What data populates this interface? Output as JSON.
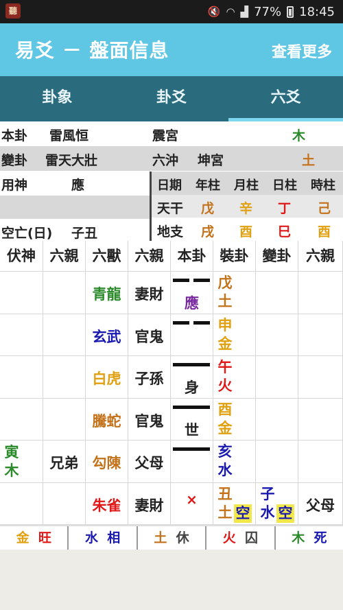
{
  "status_bar": {
    "battery": "77%",
    "time": "18:45",
    "app_icon": "聽"
  },
  "app_bar": {
    "title": "易爻 － 盤面信息",
    "more_button": "查看更多"
  },
  "tabs": [
    {
      "label": "卦象"
    },
    {
      "label": "卦爻"
    },
    {
      "label": "六爻"
    }
  ],
  "info": {
    "ben_gua_label": "本卦",
    "ben_gua_name": "雷風恒",
    "ben_gua_palace": "震宮",
    "ben_gua_element": "木",
    "bian_gua_label": "變卦",
    "bian_gua_name": "雷天大壯",
    "bian_gua_type": "六沖",
    "bian_gua_palace": "坤宮",
    "bian_gua_element": "土",
    "yong_shen_label": "用神",
    "yong_shen_value": "應",
    "kong_wang_label": "空亡(日)",
    "kong_wang_value": "子丑",
    "pillars_header": [
      "日期",
      "年柱",
      "月柱",
      "日柱",
      "時柱"
    ],
    "tiangan_label": "天干",
    "tiangan": [
      "戊",
      "辛",
      "丁",
      "己"
    ],
    "dizhi_label": "地支",
    "dizhi": [
      "戌",
      "酉",
      "巳",
      "酉"
    ]
  },
  "grid": {
    "headers": [
      "伏神",
      "六親",
      "六獸",
      "六親",
      "本卦",
      "裝卦",
      "變卦",
      "六親"
    ],
    "rows": [
      {
        "fushen": [
          "",
          ""
        ],
        "fushen_liuqin": "",
        "beast": "青龍",
        "liuqin": "妻財",
        "yao_mark": "應",
        "zhuang": [
          "戊",
          "土"
        ],
        "bian": [
          "",
          ""
        ],
        "bian_liuqin": ""
      },
      {
        "fushen": [
          "",
          ""
        ],
        "fushen_liuqin": "",
        "beast": "玄武",
        "liuqin": "官鬼",
        "yao_mark": "",
        "zhuang": [
          "申",
          "金"
        ],
        "bian": [
          "",
          ""
        ],
        "bian_liuqin": ""
      },
      {
        "fushen": [
          "",
          ""
        ],
        "fushen_liuqin": "",
        "beast": "白虎",
        "liuqin": "子孫",
        "yao_mark": "身",
        "zhuang": [
          "午",
          "火"
        ],
        "bian": [
          "",
          ""
        ],
        "bian_liuqin": ""
      },
      {
        "fushen": [
          "",
          ""
        ],
        "fushen_liuqin": "",
        "beast": "騰蛇",
        "liuqin": "官鬼",
        "yao_mark": "世",
        "zhuang": [
          "酉",
          "金"
        ],
        "bian": [
          "",
          ""
        ],
        "bian_liuqin": ""
      },
      {
        "fushen": [
          "寅",
          "木"
        ],
        "fushen_liuqin": "兄弟",
        "beast": "勾陳",
        "liuqin": "父母",
        "yao_mark": "",
        "zhuang": [
          "亥",
          "水"
        ],
        "bian": [
          "",
          ""
        ],
        "bian_liuqin": ""
      },
      {
        "fushen": [
          "",
          ""
        ],
        "fushen_liuqin": "",
        "beast": "朱雀",
        "liuqin": "妻財",
        "yao_mark": "×",
        "zhuang": [
          "丑",
          "土"
        ],
        "zhuang_badge": "空",
        "bian": [
          "子",
          "水"
        ],
        "bian_badge": "空",
        "bian_liuqin": "父母"
      }
    ]
  },
  "footer": [
    {
      "element": "金",
      "state": "旺"
    },
    {
      "element": "水",
      "state": "相"
    },
    {
      "element": "土",
      "state": "休"
    },
    {
      "element": "火",
      "state": "囚"
    },
    {
      "element": "木",
      "state": "死"
    }
  ],
  "colors": {
    "wood": "#2a8a2a",
    "fire": "#e01818",
    "earth": "#c4721a",
    "metal": "#e0a010",
    "water": "#1a1ab0",
    "yao_mark": "#7a2aa0",
    "app_bar": "#5fc6e4",
    "tab_bar": "#2a6c7e"
  }
}
